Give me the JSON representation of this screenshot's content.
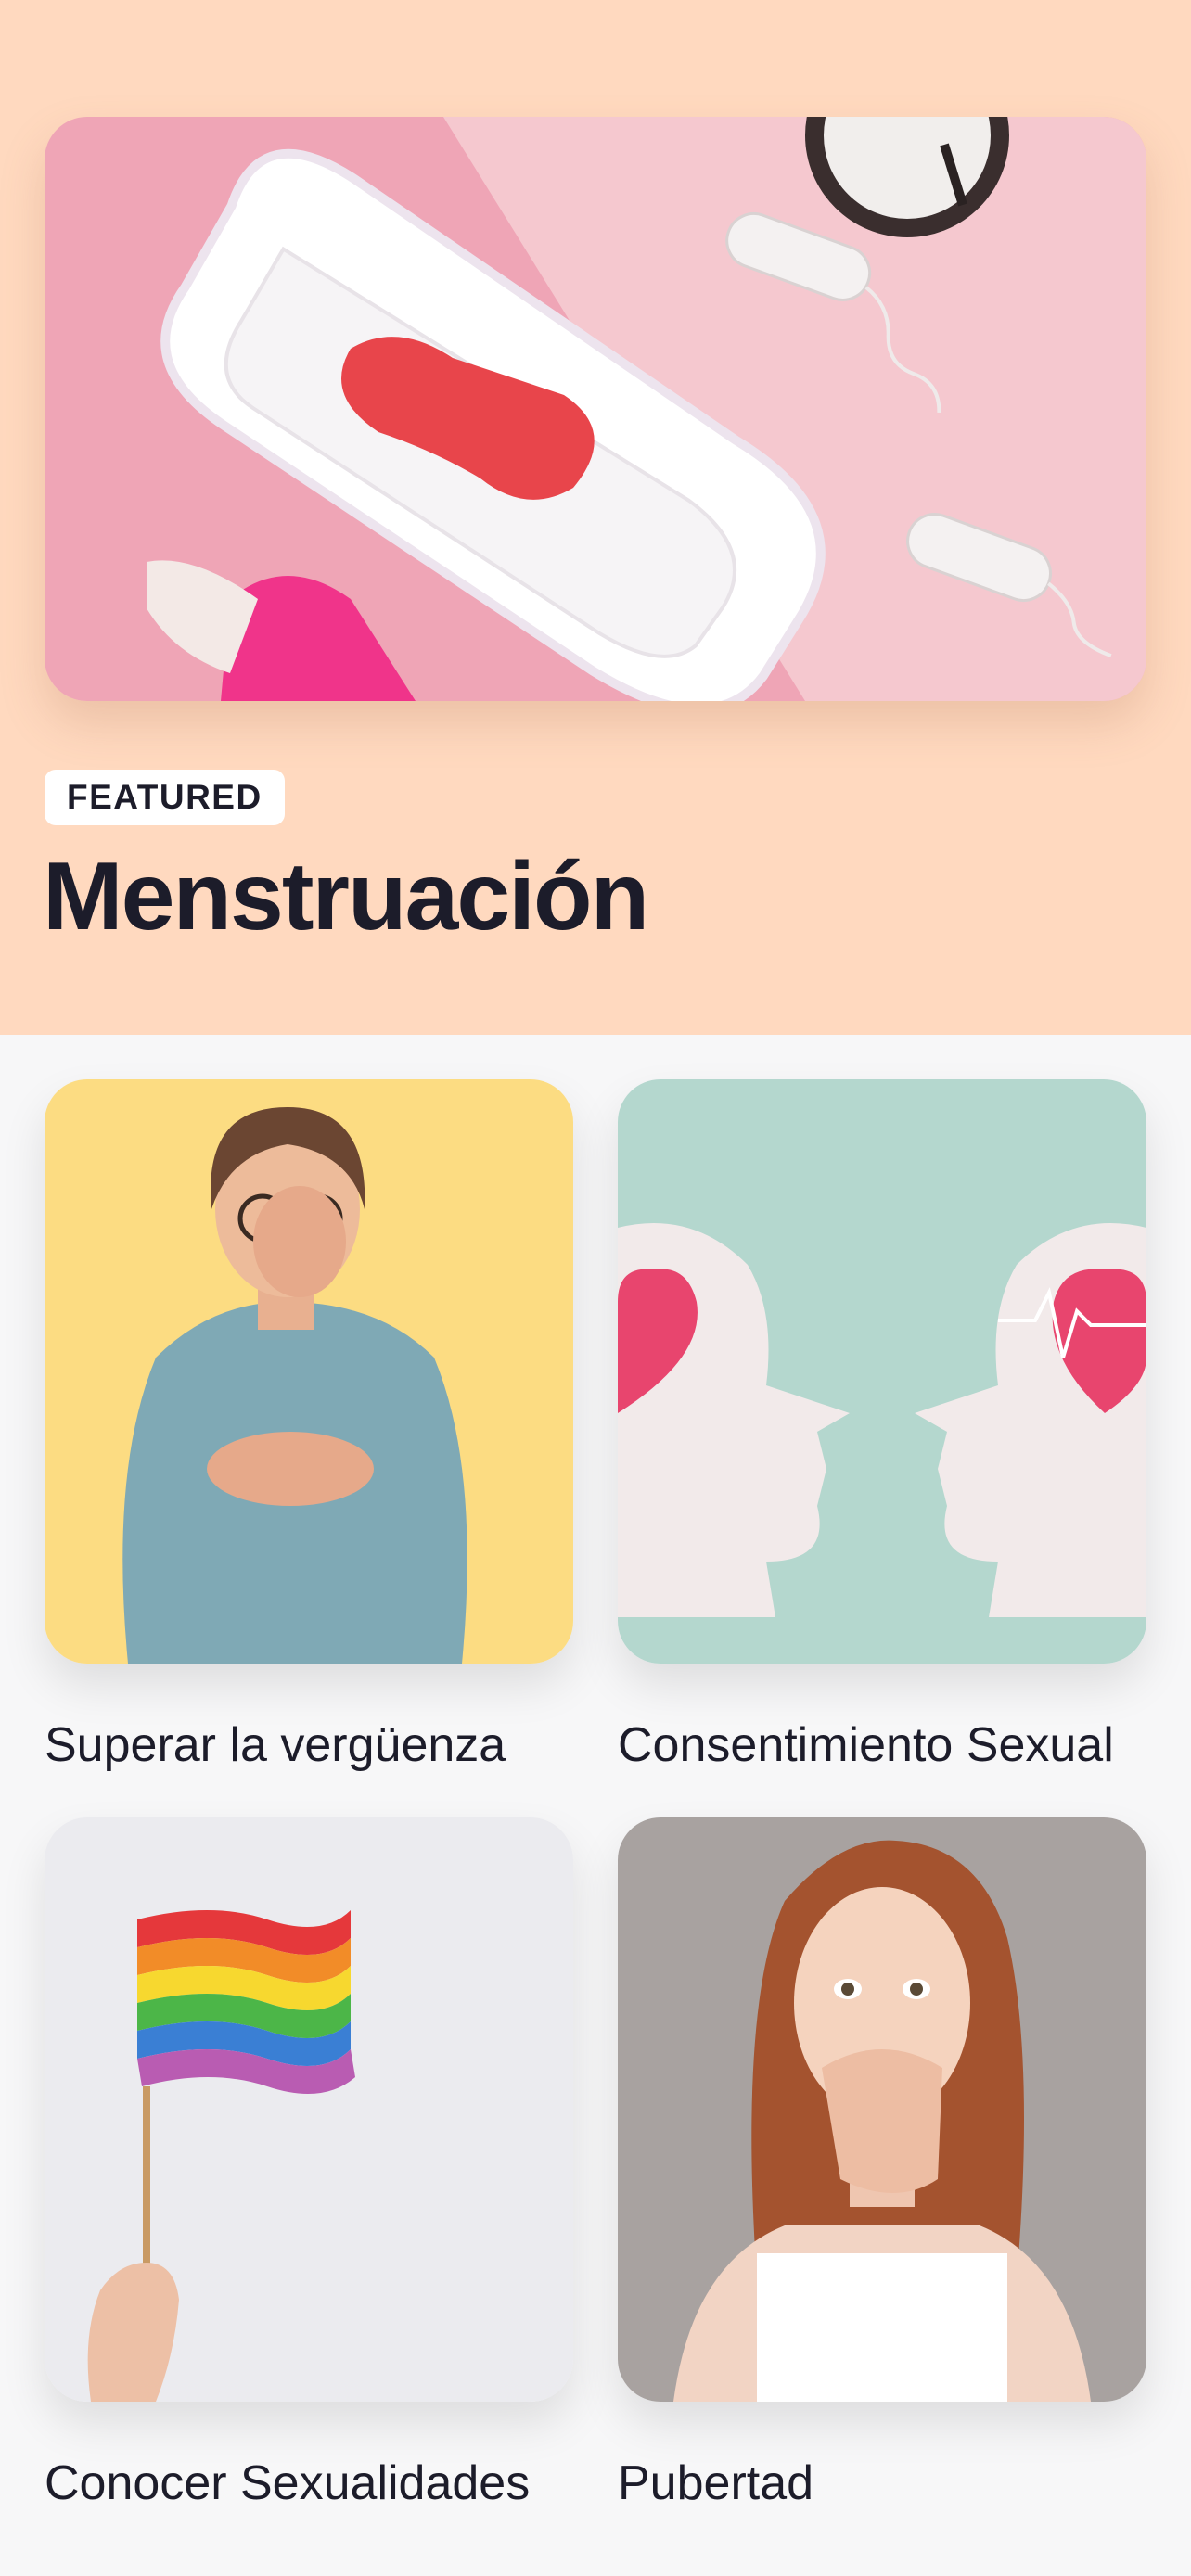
{
  "featured": {
    "badge": "FEATURED",
    "title": "Menstruación",
    "image": "menstrual-products-photo"
  },
  "topics": [
    {
      "label": "Superar la vergüenza",
      "image": "embarrassed-woman-photo"
    },
    {
      "label": "Consentimiento Sexual",
      "image": "paper-heads-hearts-photo"
    },
    {
      "label": "Conocer Sexualidades",
      "image": "rainbow-flag-photo"
    },
    {
      "label": "Pubertad",
      "image": "surprised-teen-photo"
    }
  ],
  "colors": {
    "featured_background": "#FFD9BF",
    "page_background": "#F7F7F8",
    "text": "#1C1C2A"
  }
}
